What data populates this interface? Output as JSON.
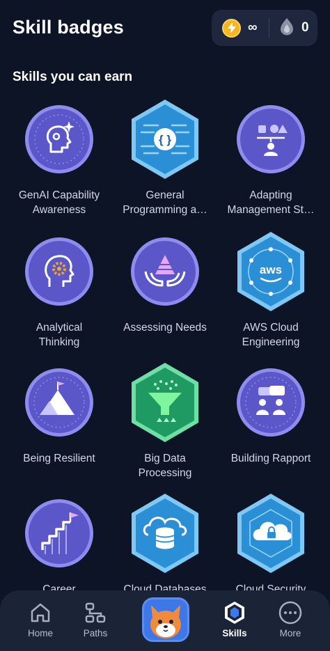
{
  "header": {
    "title": "Skill badges",
    "energy_value": "∞",
    "energy_icon": "lightning-coin-icon",
    "gems_value": "0",
    "gems_icon": "flame-drop-icon"
  },
  "section": {
    "title": "Skills you can earn"
  },
  "badges": [
    {
      "label": "GenAI Capability\nAwareness",
      "icon": "ai-head-sparkle-icon",
      "shape": "circle"
    },
    {
      "label": "General\nProgramming a…",
      "icon": "code-braces-icon",
      "shape": "hexagon"
    },
    {
      "label": "Adapting\nManagement St…",
      "icon": "shapes-manager-icon",
      "shape": "circle"
    },
    {
      "label": "Analytical\nThinking",
      "icon": "gear-head-icon",
      "shape": "circle"
    },
    {
      "label": "Assessing Needs",
      "icon": "hands-pyramid-icon",
      "shape": "circle"
    },
    {
      "label": "AWS Cloud\nEngineering",
      "icon": "aws-cloud-icon",
      "shape": "hexagon"
    },
    {
      "label": "Being Resilient",
      "icon": "mountain-flag-icon",
      "shape": "circle"
    },
    {
      "label": "Big Data\nProcessing",
      "icon": "data-funnel-icon",
      "shape": "hexagon"
    },
    {
      "label": "Building Rapport",
      "icon": "people-chat-icon",
      "shape": "circle"
    },
    {
      "label": "Career",
      "icon": "stairs-flag-icon",
      "shape": "circle"
    },
    {
      "label": "Cloud Databases",
      "icon": "cloud-database-icon",
      "shape": "hexagon"
    },
    {
      "label": "Cloud Security",
      "icon": "cloud-lock-icon",
      "shape": "hexagon"
    }
  ],
  "nav": {
    "home": "Home",
    "paths": "Paths",
    "skills": "Skills",
    "more": "More",
    "active": "skills"
  },
  "colors": {
    "background": "#0d1426",
    "nav_background": "#1b2336",
    "circle_badge": "#5b57c9",
    "hex_blue": "#2b8fd6",
    "hex_green": "#1f9a63",
    "mascot_bg": "#3e78e8"
  }
}
